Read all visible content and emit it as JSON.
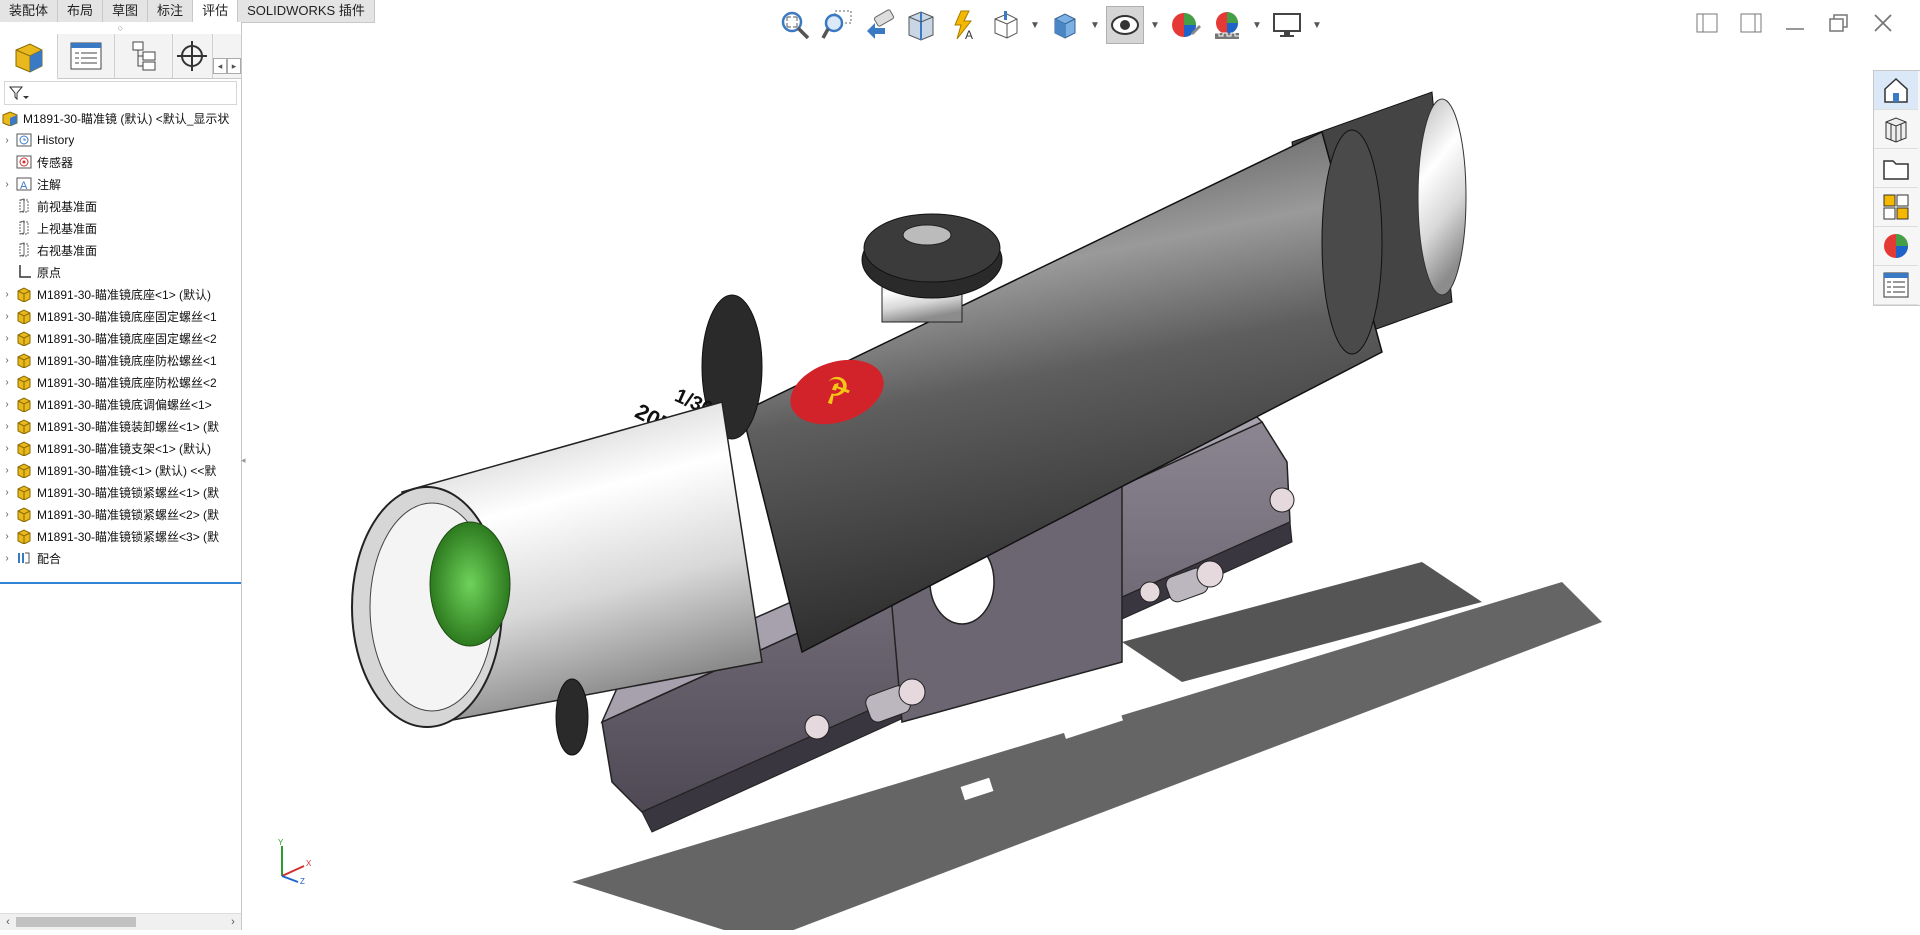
{
  "command_tabs": [
    {
      "label": "装配体",
      "active": false
    },
    {
      "label": "布局",
      "active": false
    },
    {
      "label": "草图",
      "active": false
    },
    {
      "label": "标注",
      "active": false
    },
    {
      "label": "评估",
      "active": true
    },
    {
      "label": "SOLIDWORKS 插件",
      "active": false
    }
  ],
  "heads_up_toolbar": [
    "zoom-to-fit-icon",
    "zoom-to-area-icon",
    "previous-view-icon",
    "section-view-icon",
    "dynamic-annotation-icon",
    "view-orientation-icon",
    "display-style-icon",
    "hide-show-items-icon",
    "edit-appearance-icon",
    "apply-scene-icon",
    "view-settings-icon"
  ],
  "feature_tree": {
    "root": "M1891-30-瞄准镜 (默认) <默认_显示状",
    "items": [
      {
        "label": "History",
        "icon": "history-icon",
        "expandable": true
      },
      {
        "label": "传感器",
        "icon": "sensor-icon",
        "expandable": false
      },
      {
        "label": "注解",
        "icon": "annotation-icon",
        "expandable": true
      },
      {
        "label": "前视基准面",
        "icon": "plane-icon",
        "expandable": false
      },
      {
        "label": "上视基准面",
        "icon": "plane-icon",
        "expandable": false
      },
      {
        "label": "右视基准面",
        "icon": "plane-icon",
        "expandable": false
      },
      {
        "label": "原点",
        "icon": "origin-icon",
        "expandable": false
      },
      {
        "label": "M1891-30-瞄准镜底座<1> (默认)",
        "icon": "part-icon",
        "expandable": true
      },
      {
        "label": "M1891-30-瞄准镜底座固定螺丝<1",
        "icon": "part-icon",
        "expandable": true
      },
      {
        "label": "M1891-30-瞄准镜底座固定螺丝<2",
        "icon": "part-icon",
        "expandable": true
      },
      {
        "label": "M1891-30-瞄准镜底座防松螺丝<1",
        "icon": "part-icon",
        "expandable": true
      },
      {
        "label": "M1891-30-瞄准镜底座防松螺丝<2",
        "icon": "part-icon",
        "expandable": true
      },
      {
        "label": "M1891-30-瞄准镜底调偏螺丝<1>",
        "icon": "part-icon",
        "expandable": true
      },
      {
        "label": "M1891-30-瞄准镜装卸螺丝<1> (默",
        "icon": "part-icon",
        "expandable": true
      },
      {
        "label": "M1891-30-瞄准镜支架<1> (默认)",
        "icon": "part-icon",
        "expandable": true
      },
      {
        "label": "M1891-30-瞄准镜<1> (默认) <<默",
        "icon": "part-icon",
        "expandable": true
      },
      {
        "label": "M1891-30-瞄准镜锁紧螺丝<1> (默",
        "icon": "part-icon",
        "expandable": true
      },
      {
        "label": "M1891-30-瞄准镜锁紧螺丝<2> (默",
        "icon": "part-icon",
        "expandable": true
      },
      {
        "label": "M1891-30-瞄准镜锁紧螺丝<3> (默",
        "icon": "part-icon",
        "expandable": true
      },
      {
        "label": "配合",
        "icon": "mates-icon",
        "expandable": true
      }
    ]
  },
  "model": {
    "engraving_line1": "1/30",
    "engraving_line2": "2051201"
  },
  "triad": {
    "x": "X",
    "y": "Y",
    "z": "Z"
  },
  "colors": {
    "accent": "#2f86d6",
    "part_yellow": "#e8b81c",
    "tab_bg": "#e4e4e4"
  }
}
